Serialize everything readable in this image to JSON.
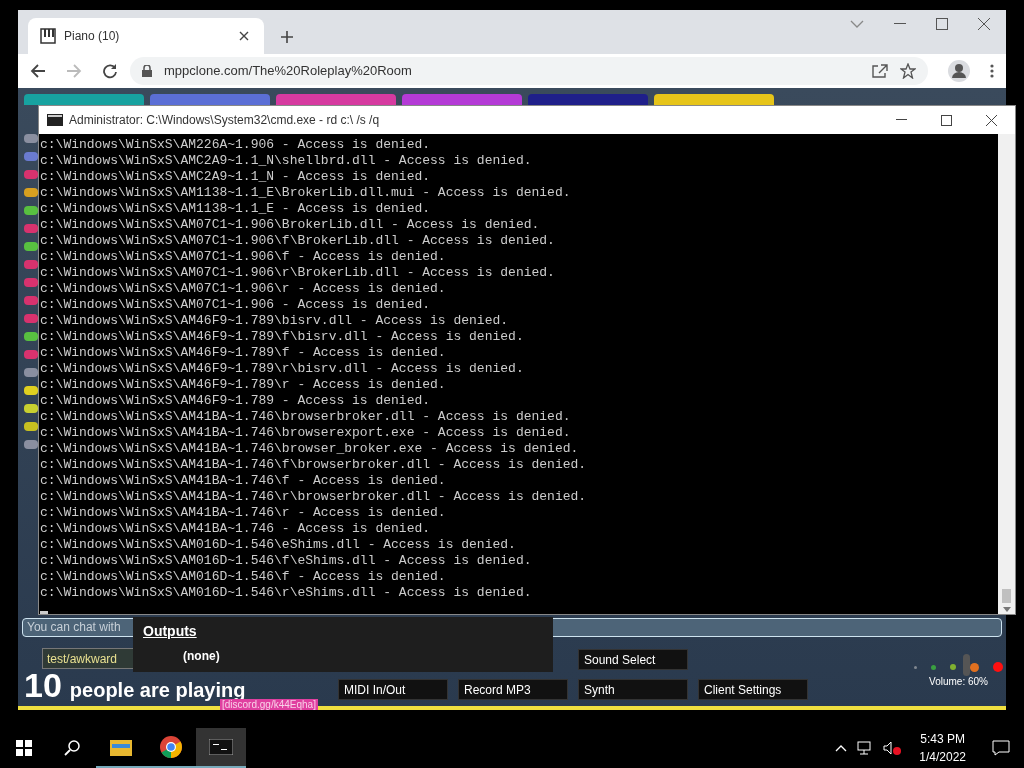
{
  "browser": {
    "tab_title": "Piano (10)",
    "url": "mppclone.com/The%20Roleplay%20Room"
  },
  "room_tabs": [
    {
      "color": "#17a2a0"
    },
    {
      "color": "#5b6fd6"
    },
    {
      "color": "#d63aa0"
    },
    {
      "color": "#b43ad6"
    },
    {
      "color": "#1f1f8a"
    },
    {
      "color": "#e6c419"
    }
  ],
  "chat_fragments": [
    {
      "color": "#8a8fa0"
    },
    {
      "color": "#6a7bd0"
    },
    {
      "color": "#d8326e"
    },
    {
      "color": "#d8a020"
    },
    {
      "color": "#58c040"
    },
    {
      "color": "#d8326e"
    },
    {
      "color": "#58c040"
    },
    {
      "color": "#d8326e"
    },
    {
      "color": "#d8326e"
    },
    {
      "color": "#d8326e"
    },
    {
      "color": "#d8326e"
    },
    {
      "color": "#58c040"
    },
    {
      "color": "#d8326e"
    },
    {
      "color": "#8a8fa0"
    },
    {
      "color": "#e0d020"
    },
    {
      "color": "#c8d030"
    },
    {
      "color": "#c8c020"
    },
    {
      "color": "#8a8fa0"
    }
  ],
  "console": {
    "title": "Administrator: C:\\Windows\\System32\\cmd.exe - rd  c:\\ /s /q",
    "lines": [
      "c:\\Windows\\WinSxS\\AM226A~1.906 - Access is denied.",
      "c:\\Windows\\WinSxS\\AMC2A9~1.1_N\\shellbrd.dll - Access is denied.",
      "c:\\Windows\\WinSxS\\AMC2A9~1.1_N - Access is denied.",
      "c:\\Windows\\WinSxS\\AM1138~1.1_E\\BrokerLib.dll.mui - Access is denied.",
      "c:\\Windows\\WinSxS\\AM1138~1.1_E - Access is denied.",
      "c:\\Windows\\WinSxS\\AM07C1~1.906\\BrokerLib.dll - Access is denied.",
      "c:\\Windows\\WinSxS\\AM07C1~1.906\\f\\BrokerLib.dll - Access is denied.",
      "c:\\Windows\\WinSxS\\AM07C1~1.906\\f - Access is denied.",
      "c:\\Windows\\WinSxS\\AM07C1~1.906\\r\\BrokerLib.dll - Access is denied.",
      "c:\\Windows\\WinSxS\\AM07C1~1.906\\r - Access is denied.",
      "c:\\Windows\\WinSxS\\AM07C1~1.906 - Access is denied.",
      "c:\\Windows\\WinSxS\\AM46F9~1.789\\bisrv.dll - Access is denied.",
      "c:\\Windows\\WinSxS\\AM46F9~1.789\\f\\bisrv.dll - Access is denied.",
      "c:\\Windows\\WinSxS\\AM46F9~1.789\\f - Access is denied.",
      "c:\\Windows\\WinSxS\\AM46F9~1.789\\r\\bisrv.dll - Access is denied.",
      "c:\\Windows\\WinSxS\\AM46F9~1.789\\r - Access is denied.",
      "c:\\Windows\\WinSxS\\AM46F9~1.789 - Access is denied.",
      "c:\\Windows\\WinSxS\\AM41BA~1.746\\browserbroker.dll - Access is denied.",
      "c:\\Windows\\WinSxS\\AM41BA~1.746\\browserexport.exe - Access is denied.",
      "c:\\Windows\\WinSxS\\AM41BA~1.746\\browser_broker.exe - Access is denied.",
      "c:\\Windows\\WinSxS\\AM41BA~1.746\\f\\browserbroker.dll - Access is denied.",
      "c:\\Windows\\WinSxS\\AM41BA~1.746\\f - Access is denied.",
      "c:\\Windows\\WinSxS\\AM41BA~1.746\\r\\browserbroker.dll - Access is denied.",
      "c:\\Windows\\WinSxS\\AM41BA~1.746\\r - Access is denied.",
      "c:\\Windows\\WinSxS\\AM41BA~1.746 - Access is denied.",
      "c:\\Windows\\WinSxS\\AM016D~1.546\\eShims.dll - Access is denied.",
      "c:\\Windows\\WinSxS\\AM016D~1.546\\f\\eShims.dll - Access is denied.",
      "c:\\Windows\\WinSxS\\AM016D~1.546\\f - Access is denied.",
      "c:\\Windows\\WinSxS\\AM016D~1.546\\r\\eShims.dll - Access is denied."
    ]
  },
  "chat": {
    "placeholder": "You can chat with"
  },
  "outputs_menu": {
    "heading": "Outputs",
    "items": [
      "(none)"
    ]
  },
  "name_field": {
    "value": "test/awkward"
  },
  "player_count": {
    "number": "10",
    "label": "people are playing"
  },
  "top_buttons": [
    "Sound Select"
  ],
  "bottom_buttons": [
    "MIDI In/Out",
    "Record MP3",
    "Synth",
    "Client Settings"
  ],
  "meter_dots": [
    {
      "color": "#808890"
    },
    {
      "color": "#3aa040"
    },
    {
      "color": "#80b030"
    },
    {
      "color": "#e07020"
    },
    {
      "color": "#ff1010"
    }
  ],
  "volume": {
    "level": 0.6,
    "label": "Volume: 60%"
  },
  "discord_link": "[discord.gg/k44Eqha]",
  "taskbar": {
    "time": "5:43 PM",
    "date": "1/4/2022"
  }
}
